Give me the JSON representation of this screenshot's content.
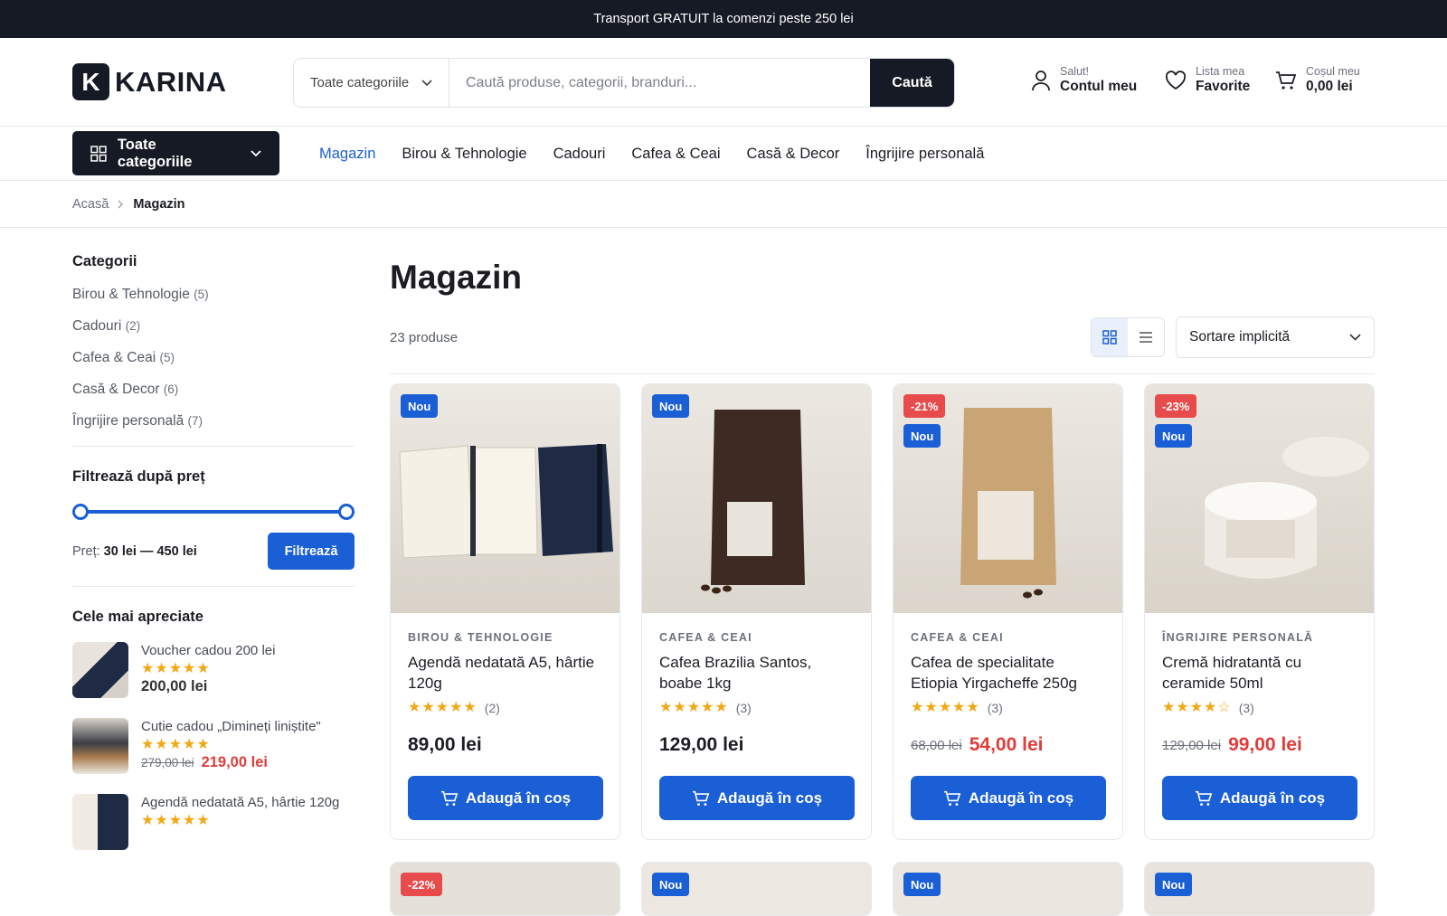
{
  "topbar": {
    "text": "Transport GRATUIT la comenzi peste 250 lei"
  },
  "logo": {
    "mark": "K",
    "text": "KARINA"
  },
  "search": {
    "category": "Toate categoriile",
    "placeholder": "Caută produse, categorii, branduri...",
    "button": "Caută"
  },
  "account": {
    "small": "Salut!",
    "big": "Contul meu",
    "icon": "user-icon"
  },
  "favorites": {
    "small": "Lista mea",
    "big": "Favorite",
    "icon": "heart-icon"
  },
  "cart": {
    "small": "Coșul meu",
    "big": "0,00 lei",
    "icon": "cart-icon"
  },
  "nav": {
    "categories_button": "Toate categoriile",
    "links": [
      "Magazin",
      "Birou & Tehnologie",
      "Cadouri",
      "Cafea & Ceai",
      "Casă & Decor",
      "Îngrijire personală"
    ],
    "active": "Magazin"
  },
  "breadcrumb": {
    "home": "Acasă",
    "current": "Magazin"
  },
  "sidebar": {
    "categories_title": "Categorii",
    "categories": [
      {
        "name": "Birou & Tehnologie",
        "count": "(5)"
      },
      {
        "name": "Cadouri",
        "count": "(2)"
      },
      {
        "name": "Cafea & Ceai",
        "count": "(5)"
      },
      {
        "name": "Casă & Decor",
        "count": "(6)"
      },
      {
        "name": "Îngrijire personală",
        "count": "(7)"
      }
    ],
    "price_title": "Filtrează după preț",
    "price_label": "Preț:",
    "price_range": "30 lei — 450 lei",
    "price_min": 30,
    "price_max": 450,
    "filter_button": "Filtrează",
    "top_title": "Cele mai apreciate",
    "top": [
      {
        "name": "Voucher cadou 200 lei",
        "stars": "★★★★★",
        "price": "200,00 lei",
        "old": ""
      },
      {
        "name": "Cutie cadou „Dimineți liniștite\"",
        "stars": "★★★★★",
        "price": "219,00 lei",
        "old": "279,00 lei"
      },
      {
        "name": "Agendă nedatată A5, hârtie 120g",
        "stars": "★★★★★",
        "price": "",
        "old": ""
      }
    ]
  },
  "main": {
    "title": "Magazin",
    "count": "23 produse",
    "sort": "Sortare implicită",
    "products": [
      {
        "category": "Birou & Tehnologie",
        "name": "Agendă nedatată A5, hârtie 120g",
        "stars": "★★★★★",
        "reviews": "(2)",
        "price": "89,00 lei",
        "old": "",
        "badges": [
          "Nou"
        ],
        "button": "Adaugă în coș"
      },
      {
        "category": "Cafea & Ceai",
        "name": "Cafea Brazilia Santos, boabe 1kg",
        "stars": "★★★★★",
        "reviews": "(3)",
        "price": "129,00 lei",
        "old": "",
        "badges": [
          "Nou"
        ],
        "button": "Adaugă în coș"
      },
      {
        "category": "Cafea & Ceai",
        "name": "Cafea de specialitate Etiopia Yirgacheffe 250g",
        "stars": "★★★★★",
        "reviews": "(3)",
        "price": "54,00 lei",
        "old": "68,00 lei",
        "badges": [
          "-21%",
          "Nou"
        ],
        "button": "Adaugă în coș"
      },
      {
        "category": "Îngrijire personală",
        "name": "Cremă hidratantă cu ceramide 50ml",
        "stars": "★★★★☆",
        "reviews": "(3)",
        "price": "99,00 lei",
        "old": "129,00 lei",
        "badges": [
          "-23%",
          "Nou"
        ],
        "button": "Adaugă în coș"
      }
    ],
    "row2_badges": [
      "-22%",
      "Nou",
      "Nou",
      "Nou"
    ]
  },
  "colors": {
    "accent": "#1a5fd6",
    "dark": "#151a24",
    "sale": "#e23b3b",
    "star": "#f3a712"
  }
}
